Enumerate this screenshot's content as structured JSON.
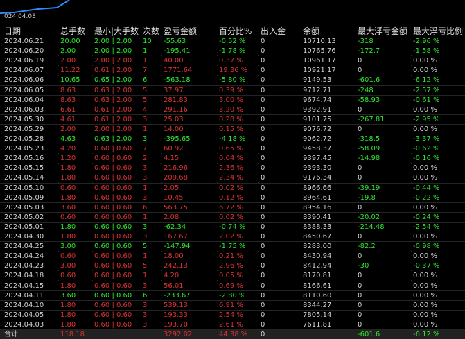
{
  "chart": {
    "x_label": "024.04.03"
  },
  "colors": {
    "up": "#2ee62e",
    "down": "#d83333",
    "neutral": "#d0d0d0",
    "header": "#d8d8d8",
    "line": "#2a8cff"
  },
  "columns": [
    "日期",
    "总手数",
    "最小|大手数",
    "次数",
    "盈亏金额",
    "百分比%",
    "出入金",
    "余额",
    "最大浮亏金额",
    "最大浮亏比例"
  ],
  "rows": [
    {
      "date": "2024.06.21",
      "lots": "20.00",
      "minmax": "2.00 | 2.00",
      "count": "10",
      "pnl": "-55.63",
      "pct": "-0.52 %",
      "io": "0",
      "bal": "10710.13",
      "fl": "-318",
      "flp": "-2.96 %",
      "c": "up"
    },
    {
      "date": "2024.06.20",
      "lots": "2.00",
      "minmax": "2.00 | 2.00",
      "count": "1",
      "pnl": "-195.41",
      "pct": "-1.78 %",
      "io": "0",
      "bal": "10765.76",
      "fl": "-172.7",
      "flp": "-1.58 %",
      "c": "up"
    },
    {
      "date": "2024.06.19",
      "lots": "2.00",
      "minmax": "2.00 | 2.00",
      "count": "1",
      "pnl": "40.00",
      "pct": "0.37 %",
      "io": "0",
      "bal": "10961.17",
      "fl": "0",
      "flp": "0.00 %",
      "c": "down"
    },
    {
      "date": "2024.06.07",
      "lots": "11.22",
      "minmax": "0.61 | 2.00",
      "count": "7",
      "pnl": "1771.64",
      "pct": "19.36 %",
      "io": "0",
      "bal": "10921.17",
      "fl": "0",
      "flp": "0.00 %",
      "c": "down"
    },
    {
      "date": "2024.06.06",
      "lots": "10.65",
      "minmax": "0.65 | 2.00",
      "count": "6",
      "pnl": "-563.18",
      "pct": "-5.80 %",
      "io": "0",
      "bal": "9149.53",
      "fl": "-601.6",
      "flp": "-6.12 %",
      "c": "up"
    },
    {
      "date": "2024.06.05",
      "lots": "8.63",
      "minmax": "0.63 | 2.00",
      "count": "5",
      "pnl": "37.97",
      "pct": "0.39 %",
      "io": "0",
      "bal": "9712.71",
      "fl": "-248",
      "flp": "-2.57 %",
      "c": "down"
    },
    {
      "date": "2024.06.04",
      "lots": "8.63",
      "minmax": "0.63 | 2.00",
      "count": "5",
      "pnl": "281.83",
      "pct": "3.00 %",
      "io": "0",
      "bal": "9674.74",
      "fl": "-58.93",
      "flp": "-0.61 %",
      "c": "down"
    },
    {
      "date": "2024.06.03",
      "lots": "6.61",
      "minmax": "0.61 | 2.00",
      "count": "4",
      "pnl": "291.16",
      "pct": "3.20 %",
      "io": "0",
      "bal": "9392.91",
      "fl": "0",
      "flp": "0.00 %",
      "c": "down"
    },
    {
      "date": "2024.05.30",
      "lots": "4.61",
      "minmax": "0.61 | 2.00",
      "count": "3",
      "pnl": "25.03",
      "pct": "0.28 %",
      "io": "0",
      "bal": "9101.75",
      "fl": "-267.81",
      "flp": "-2.95 %",
      "c": "down"
    },
    {
      "date": "2024.05.29",
      "lots": "2.00",
      "minmax": "2.00 | 2.00",
      "count": "1",
      "pnl": "14.00",
      "pct": "0.15 %",
      "io": "0",
      "bal": "9076.72",
      "fl": "0",
      "flp": "0.00 %",
      "c": "down"
    },
    {
      "date": "2024.05.28",
      "lots": "4.63",
      "minmax": "0.63 | 2.00",
      "count": "3",
      "pnl": "-395.65",
      "pct": "-4.18 %",
      "io": "0",
      "bal": "9062.72",
      "fl": "-318.5",
      "flp": "-3.37 %",
      "c": "up"
    },
    {
      "date": "2024.05.23",
      "lots": "4.20",
      "minmax": "0.60 | 0.60",
      "count": "7",
      "pnl": "60.92",
      "pct": "0.65 %",
      "io": "0",
      "bal": "9458.37",
      "fl": "-58.09",
      "flp": "-0.62 %",
      "c": "down"
    },
    {
      "date": "2024.05.16",
      "lots": "1.20",
      "minmax": "0.60 | 0.60",
      "count": "2",
      "pnl": "4.15",
      "pct": "0.04 %",
      "io": "0",
      "bal": "9397.45",
      "fl": "-14.98",
      "flp": "-0.16 %",
      "c": "down"
    },
    {
      "date": "2024.05.15",
      "lots": "1.80",
      "minmax": "0.60 | 0.60",
      "count": "3",
      "pnl": "216.96",
      "pct": "2.36 %",
      "io": "0",
      "bal": "9393.30",
      "fl": "0",
      "flp": "0.00 %",
      "c": "down"
    },
    {
      "date": "2024.05.14",
      "lots": "1.80",
      "minmax": "0.60 | 0.60",
      "count": "3",
      "pnl": "209.68",
      "pct": "2.34 %",
      "io": "0",
      "bal": "9176.34",
      "fl": "0",
      "flp": "0.00 %",
      "c": "down"
    },
    {
      "date": "2024.05.10",
      "lots": "0.60",
      "minmax": "0.60 | 0.60",
      "count": "1",
      "pnl": "2.05",
      "pct": "0.02 %",
      "io": "0",
      "bal": "8966.66",
      "fl": "-39.19",
      "flp": "-0.44 %",
      "c": "down"
    },
    {
      "date": "2024.05.09",
      "lots": "1.80",
      "minmax": "0.60 | 0.60",
      "count": "3",
      "pnl": "10.45",
      "pct": "0.12 %",
      "io": "0",
      "bal": "8964.61",
      "fl": "-19.8",
      "flp": "-0.22 %",
      "c": "down"
    },
    {
      "date": "2024.05.03",
      "lots": "3.60",
      "minmax": "0.60 | 0.60",
      "count": "6",
      "pnl": "563.75",
      "pct": "6.72 %",
      "io": "0",
      "bal": "8954.16",
      "fl": "0",
      "flp": "0.00 %",
      "c": "down"
    },
    {
      "date": "2024.05.02",
      "lots": "0.60",
      "minmax": "0.60 | 0.60",
      "count": "1",
      "pnl": "2.08",
      "pct": "0.02 %",
      "io": "0",
      "bal": "8390.41",
      "fl": "-20.02",
      "flp": "-0.24 %",
      "c": "down"
    },
    {
      "date": "2024.05.01",
      "lots": "1.80",
      "minmax": "0.60 | 0.60",
      "count": "3",
      "pnl": "-62.34",
      "pct": "-0.74 %",
      "io": "0",
      "bal": "8388.33",
      "fl": "-214.48",
      "flp": "-2.54 %",
      "c": "up"
    },
    {
      "date": "2024.04.30",
      "lots": "1.80",
      "minmax": "0.60 | 0.60",
      "count": "3",
      "pnl": "167.67",
      "pct": "2.02 %",
      "io": "0",
      "bal": "8450.67",
      "fl": "0",
      "flp": "0.00 %",
      "c": "down"
    },
    {
      "date": "2024.04.25",
      "lots": "3.00",
      "minmax": "0.60 | 0.60",
      "count": "5",
      "pnl": "-147.94",
      "pct": "-1.75 %",
      "io": "0",
      "bal": "8283.00",
      "fl": "-82.2",
      "flp": "-0.98 %",
      "c": "up"
    },
    {
      "date": "2024.04.24",
      "lots": "0.60",
      "minmax": "0.60 | 0.60",
      "count": "1",
      "pnl": "18.00",
      "pct": "0.21 %",
      "io": "0",
      "bal": "8430.94",
      "fl": "0",
      "flp": "0.00 %",
      "c": "down"
    },
    {
      "date": "2024.04.23",
      "lots": "3.00",
      "minmax": "0.60 | 0.60",
      "count": "5",
      "pnl": "242.13",
      "pct": "2.96 %",
      "io": "0",
      "bal": "8412.94",
      "fl": "-30",
      "flp": "-0.37 %",
      "c": "down"
    },
    {
      "date": "2024.04.18",
      "lots": "0.60",
      "minmax": "0.60 | 0.60",
      "count": "1",
      "pnl": "4.20",
      "pct": "0.05 %",
      "io": "0",
      "bal": "8170.81",
      "fl": "0",
      "flp": "0.00 %",
      "c": "down"
    },
    {
      "date": "2024.04.15",
      "lots": "1.80",
      "minmax": "0.60 | 0.60",
      "count": "3",
      "pnl": "56.01",
      "pct": "0.69 %",
      "io": "0",
      "bal": "8166.61",
      "fl": "0",
      "flp": "0.00 %",
      "c": "down"
    },
    {
      "date": "2024.04.11",
      "lots": "3.60",
      "minmax": "0.60 | 0.60",
      "count": "6",
      "pnl": "-233.67",
      "pct": "-2.80 %",
      "io": "0",
      "bal": "8110.60",
      "fl": "0",
      "flp": "0.00 %",
      "c": "up"
    },
    {
      "date": "2024.04.10",
      "lots": "1.80",
      "minmax": "0.60 | 0.60",
      "count": "3",
      "pnl": "539.13",
      "pct": "6.91 %",
      "io": "0",
      "bal": "8344.27",
      "fl": "0",
      "flp": "0.00 %",
      "c": "down"
    },
    {
      "date": "2024.04.05",
      "lots": "1.80",
      "minmax": "0.60 | 0.60",
      "count": "3",
      "pnl": "193.33",
      "pct": "2.54 %",
      "io": "0",
      "bal": "7805.14",
      "fl": "0",
      "flp": "0.00 %",
      "c": "down"
    },
    {
      "date": "2024.04.03",
      "lots": "1.80",
      "minmax": "0.60 | 0.60",
      "count": "3",
      "pnl": "193.70",
      "pct": "2.61 %",
      "io": "0",
      "bal": "7611.81",
      "fl": "0",
      "flp": "0.00 %",
      "c": "down"
    }
  ],
  "total": {
    "label": "合计",
    "lots": "118.18",
    "minmax": "",
    "count": "",
    "pnl": "3292.02",
    "pct": "44.38 %",
    "io": "0",
    "bal": "",
    "fl": "-601.6",
    "flp": "-6.12 %"
  }
}
